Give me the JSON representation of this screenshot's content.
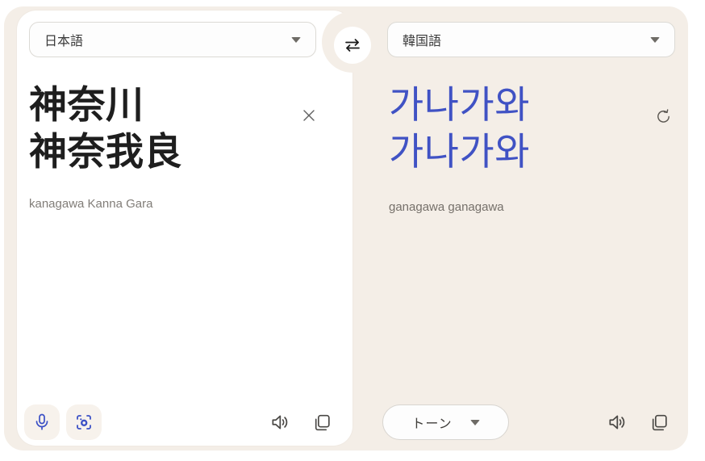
{
  "colors": {
    "accent_blue": "#4052c4",
    "panel_beige": "#f4eee7",
    "card_white": "#ffffff",
    "icon_gray": "#4a4845"
  },
  "swap_button": {
    "icon": "swap-arrows"
  },
  "source_panel": {
    "language_selector": {
      "value": "日本語",
      "icon": "chevron-down"
    },
    "text_lines": [
      "神奈川",
      "神奈我良"
    ],
    "romanization": "kanagawa Kanna Gara",
    "icons": {
      "close": "close",
      "mic": "microphone",
      "camera": "camera-scan",
      "speaker": "speaker",
      "copy": "copy"
    }
  },
  "target_panel": {
    "language_selector": {
      "value": "韓国語",
      "icon": "chevron-down"
    },
    "text_lines": [
      "가나가와",
      "가나가와"
    ],
    "romanization": "ganagawa ganagawa",
    "tone_selector": {
      "label": "トーン",
      "icon": "chevron-down"
    },
    "icons": {
      "refresh": "refresh",
      "speaker": "speaker",
      "copy": "copy"
    }
  }
}
